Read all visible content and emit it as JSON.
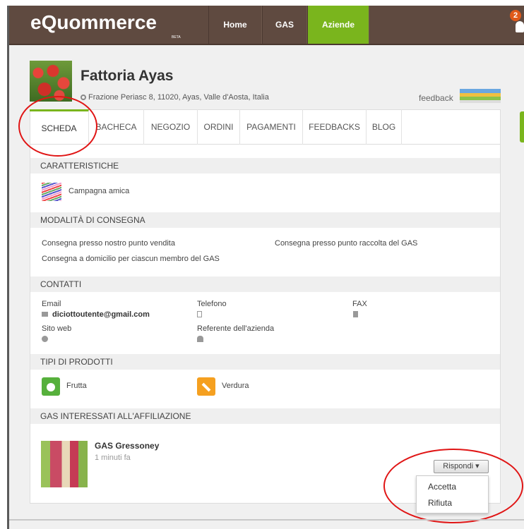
{
  "app": {
    "logo": "eQuommerce",
    "logo_badge": "BETA",
    "nav": {
      "home": "Home",
      "gas": "GAS",
      "aziende": "Aziende"
    },
    "notification_count": "2"
  },
  "company": {
    "name": "Fattoria Ayas",
    "address": "Frazione Periasc 8, 11020, Ayas, Valle d'Aosta, Italia",
    "feedback_label": "feedback"
  },
  "tabs": [
    "SCHEDA",
    "BACHECA",
    "NEGOZIO",
    "ORDINI",
    "PAGAMENTI",
    "FEEDBACKS",
    "BLOG"
  ],
  "active_tab": "SCHEDA",
  "sections": {
    "caratteristiche": {
      "title": "CARATTERISTICHE",
      "item": "Campagna amica"
    },
    "consegna": {
      "title": "MODALITÀ DI CONSEGNA",
      "items": [
        "Consegna presso nostro punto vendita",
        "Consegna presso punto raccolta del GAS",
        "Consegna a domicilio per ciascun membro del GAS"
      ]
    },
    "contatti": {
      "title": "CONTATTI",
      "email_label": "Email",
      "email_value": "diciottoutente@gmail.com",
      "telefono_label": "Telefono",
      "fax_label": "FAX",
      "sito_label": "Sito web",
      "referente_label": "Referente dell'azienda"
    },
    "prodotti": {
      "title": "TIPI DI PRODOTTI",
      "items": [
        "Frutta",
        "Verdura"
      ]
    },
    "gas": {
      "title": "GAS INTERESSATI ALL'AFFILIAZIONE",
      "name": "GAS Gressoney",
      "time": "1 minuti fa",
      "reply_label": "Rispondi",
      "options": [
        "Accetta",
        "Rifiuta"
      ]
    }
  },
  "colors": {
    "topbar": "#5f4a40",
    "accent": "#7ab51d",
    "annotation": "#e01515"
  }
}
